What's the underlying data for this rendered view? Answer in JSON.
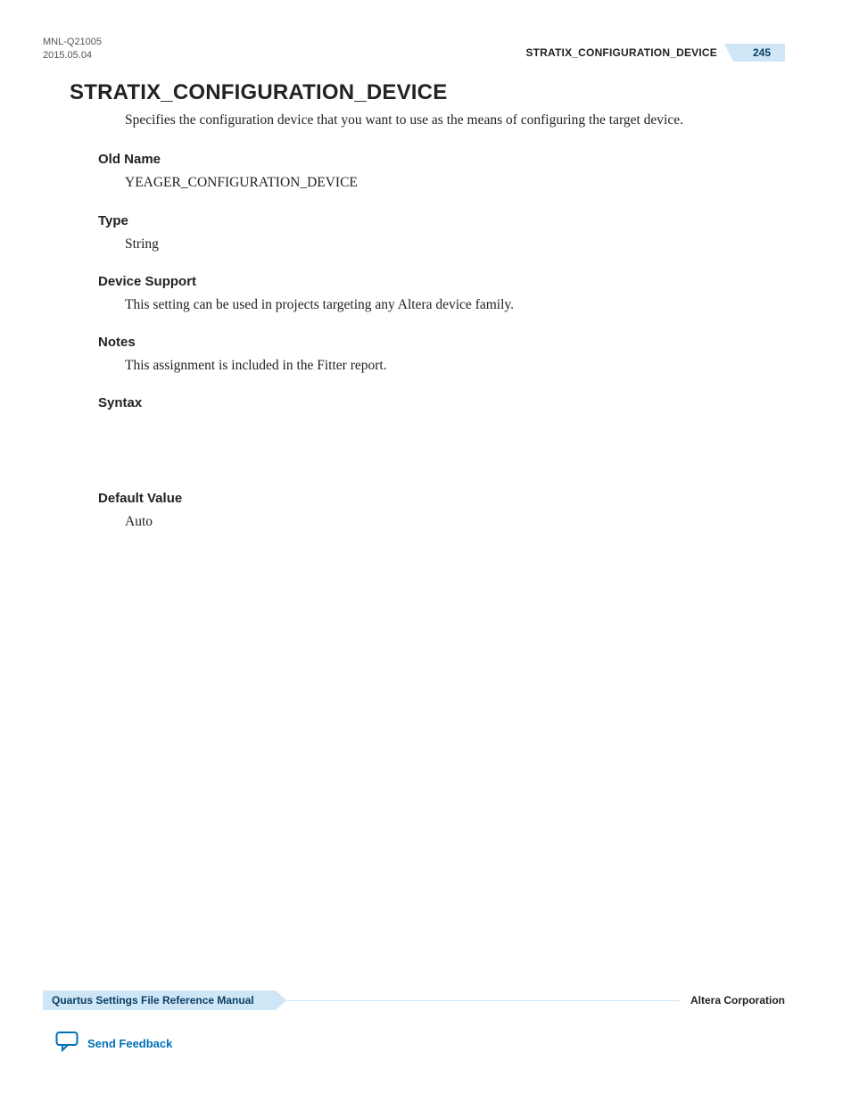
{
  "meta": {
    "doc_id": "MNL-Q21005",
    "date": "2015.05.04"
  },
  "header": {
    "title": "STRATIX_CONFIGURATION_DEVICE",
    "page_number": "245"
  },
  "main": {
    "heading": "STRATIX_CONFIGURATION_DEVICE",
    "intro": "Specifies the configuration device that you want to use as the means of configuring the target device.",
    "sections": {
      "old_name": {
        "label": "Old Name",
        "value": "YEAGER_CONFIGURATION_DEVICE"
      },
      "type": {
        "label": "Type",
        "value": "String"
      },
      "device_support": {
        "label": "Device Support",
        "value": "This setting can be used in projects targeting any Altera device family."
      },
      "notes": {
        "label": "Notes",
        "value": "This assignment is included in the Fitter report."
      },
      "syntax": {
        "label": "Syntax"
      },
      "default_value": {
        "label": "Default Value",
        "value": "Auto"
      }
    }
  },
  "footer": {
    "left": "Quartus Settings File Reference Manual",
    "right": "Altera Corporation",
    "feedback": "Send Feedback"
  }
}
